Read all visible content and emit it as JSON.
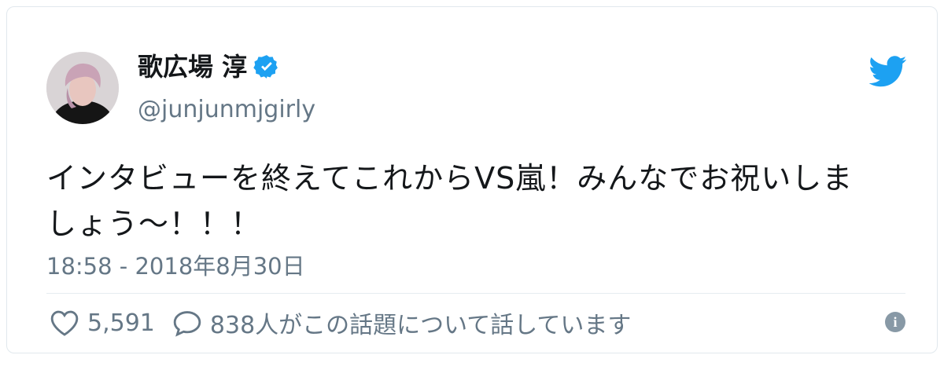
{
  "author": {
    "display_name": "歌広場 淳",
    "handle": "@junjunmjgirly",
    "verified": true
  },
  "tweet": {
    "text_line1": "インタビューを終えてこれからVS嵐！みんなでお祝いしま",
    "text_line2": "しょう～！！！",
    "timestamp": "18:58 - 2018年8月30日"
  },
  "actions": {
    "like_count": "5,591",
    "reply_summary": "838人がこの話題について話しています"
  },
  "icons": {
    "like": "heart-icon",
    "reply": "speech-bubble-icon",
    "info": "info-icon",
    "brand": "twitter-bird-icon",
    "verified": "verified-badge-icon"
  },
  "colors": {
    "brand_blue": "#1da1f2",
    "muted_text": "#657786",
    "info_icon": "#8899a6"
  }
}
